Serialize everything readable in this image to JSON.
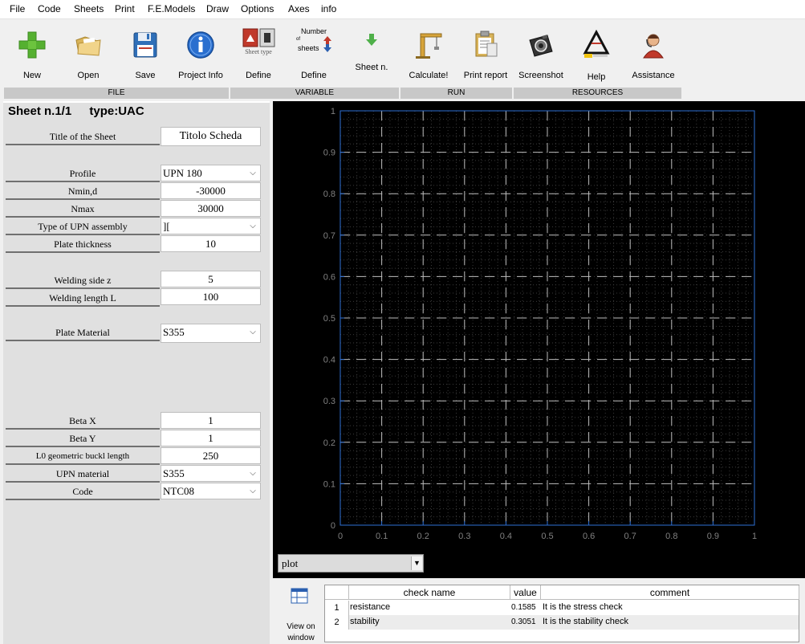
{
  "menu": [
    "File",
    "Code",
    "Sheets",
    "Print",
    "F.E.Models",
    "Draw",
    "Options",
    "Axes",
    "info"
  ],
  "toolbar": {
    "buttons": [
      {
        "label": "New",
        "icon": "plus-icon"
      },
      {
        "label": "Open",
        "icon": "folder-icon"
      },
      {
        "label": "Save",
        "icon": "floppy-icon"
      },
      {
        "label": "Project Info",
        "icon": "info-icon"
      },
      {
        "label": "Define",
        "icon": "sheet-type-icon",
        "icon_text": "Sheet type"
      },
      {
        "label": "Define",
        "icon": "number-of-sheets-icon",
        "icon_text": [
          "Number",
          "of",
          "sheets"
        ]
      },
      {
        "label": "Sheet n.",
        "icon": "arrow-down-icon"
      },
      {
        "label": "Calculate!",
        "icon": "crane-icon"
      },
      {
        "label": "Print report",
        "icon": "clipboard-icon"
      },
      {
        "label": "Screenshot",
        "icon": "camera-icon"
      },
      {
        "label": "Help",
        "icon": "help-logo-icon"
      },
      {
        "label": "Assistance",
        "icon": "support-person-icon"
      }
    ],
    "sections": [
      "FILE",
      "VARIABLE",
      "RUN",
      "RESOURCES"
    ]
  },
  "sheet": {
    "title": "Sheet n.1/1",
    "type": "type:UAC",
    "fields": [
      {
        "label": "Title of the Sheet",
        "value": "Titolo Scheda",
        "kind": "input"
      },
      {
        "label": "Profile",
        "value": "UPN 180",
        "kind": "select"
      },
      {
        "label": "Nmin,d",
        "value": "-30000",
        "kind": "input"
      },
      {
        "label": "Nmax",
        "value": "30000",
        "kind": "input"
      },
      {
        "label": "Type of UPN assembly",
        "value": "][",
        "kind": "select"
      },
      {
        "label": "Plate thickness",
        "value": "10",
        "kind": "input"
      },
      {
        "label": "Welding side z",
        "value": "5",
        "kind": "input"
      },
      {
        "label": "Welding length L",
        "value": "100",
        "kind": "input"
      },
      {
        "label": "Plate Material",
        "value": "S355",
        "kind": "select"
      },
      {
        "label": "Beta X",
        "value": "1",
        "kind": "input"
      },
      {
        "label": "Beta Y",
        "value": "1",
        "kind": "input"
      },
      {
        "label": "L0 geometric buckl length",
        "value": "250",
        "kind": "input"
      },
      {
        "label": "UPN material",
        "value": "S355",
        "kind": "select"
      },
      {
        "label": "Code",
        "value": "NTC08",
        "kind": "select"
      }
    ]
  },
  "plot": {
    "x_ticks": [
      "0",
      "0.1",
      "0.2",
      "0.3",
      "0.4",
      "0.5",
      "0.6",
      "0.7",
      "0.8",
      "0.9",
      "1"
    ],
    "y_ticks": [
      "0",
      "0.1",
      "0.2",
      "0.3",
      "0.4",
      "0.5",
      "0.6",
      "0.7",
      "0.8",
      "0.9",
      "1"
    ],
    "xlim": [
      0,
      1
    ],
    "ylim": [
      0,
      1
    ],
    "grid": true,
    "background": "#000000",
    "axis_color": "#2e6fd4",
    "selector_value": "plot"
  },
  "bottom": {
    "view_label": [
      "View on",
      "window"
    ],
    "results": {
      "headers": [
        "check name",
        "value",
        "comment"
      ],
      "rows": [
        {
          "n": "1",
          "name": "resistance",
          "value": "0.1585",
          "comment": "It is the stress check"
        },
        {
          "n": "2",
          "name": "stability",
          "value": "0.3051",
          "comment": "It is the stability check"
        }
      ]
    }
  }
}
